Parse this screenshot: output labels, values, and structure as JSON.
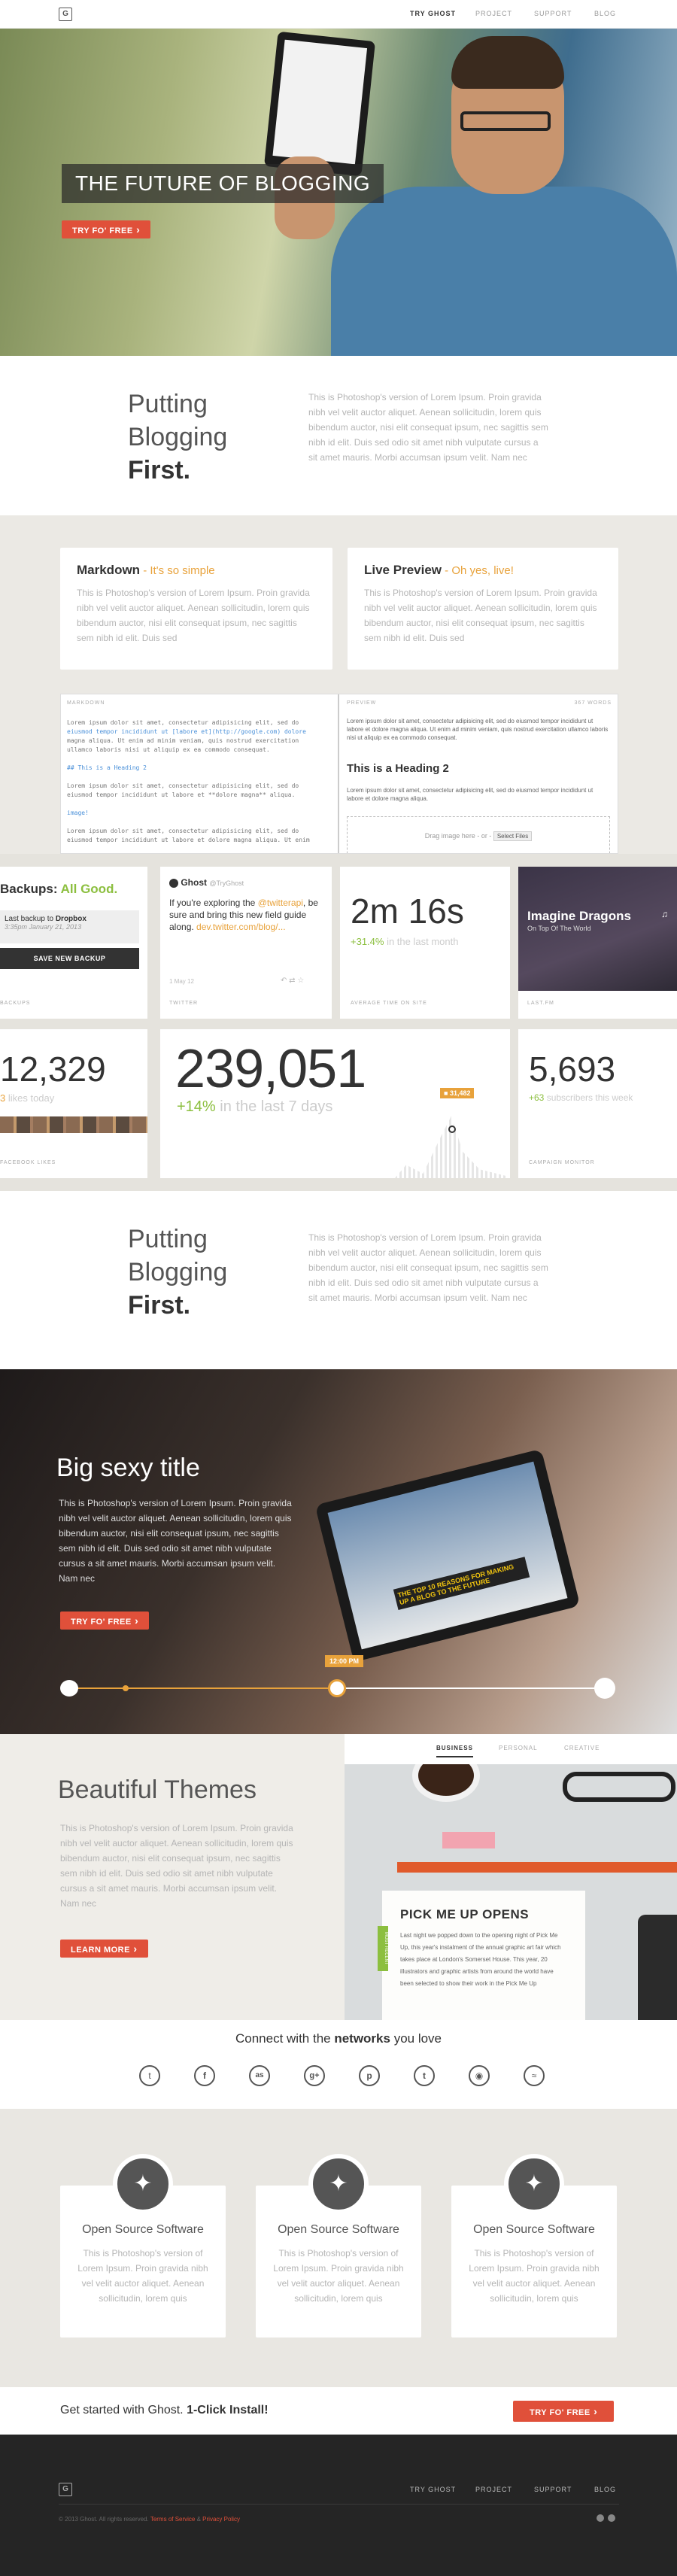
{
  "nav": {
    "logo": "G",
    "links": [
      "TRY GHOST",
      "PROJECT",
      "SUPPORT",
      "BLOG"
    ]
  },
  "hero": {
    "title": "THE FUTURE OF BLOGGING",
    "cta": "TRY FO' FREE"
  },
  "intro": {
    "line1": "Putting",
    "line2": "Blogging",
    "line3": "First.",
    "body": "This is Photoshop's version of Lorem Ipsum. Proin gravida nibh vel velit auctor aliquet. Aenean sollicitudin, lorem quis bibendum auctor, nisi elit consequat ipsum, nec sagittis sem nibh id elit. Duis sed odio sit amet nibh vulputate cursus a sit amet mauris. Morbi accumsan ipsum velit. Nam nec"
  },
  "editor": {
    "markdown_title": "Markdown",
    "markdown_sub": " - It's so simple",
    "markdown_body": "This is Photoshop's version of Lorem Ipsum. Proin gravida nibh vel velit auctor aliquet. Aenean sollicitudin, lorem quis bibendum auctor, nisi elit consequat ipsum, nec sagittis sem nibh id elit. Duis sed",
    "preview_title": "Live Preview",
    "preview_sub": " - Oh yes, live!",
    "preview_body": "This is Photoshop's version of Lorem Ipsum. Proin gravida nibh vel velit auctor aliquet. Aenean sollicitudin, lorem quis bibendum auctor, nisi elit consequat ipsum, nec sagittis sem nibh id elit. Duis sed",
    "md_label": "MARKDOWN",
    "pv_label": "PREVIEW",
    "word_count": "367 WORDS",
    "md_lines": [
      "Lorem ipsum dolor sit amet, consectetur adipisicing elit, sed do",
      "eiusmod tempor incididunt ut [labore et](http://google.com) dolore",
      "magna aliqua. Ut enim ad minim veniam, quis nostrud exercitation",
      "ullamco laboris nisi ut aliquip ex ea commodo consequat."
    ],
    "md_heading": "## This is a Heading 2",
    "md_lines2": [
      "Lorem ipsum dolor sit amet, consectetur adipisicing elit, sed do",
      "eiusmod tempor incididunt ut labore et **dolore magna** aliqua."
    ],
    "md_image": "image!",
    "md_lines3": [
      "Lorem ipsum dolor sit amet, consectetur adipisicing elit, sed do",
      "eiusmod tempor incididunt ut labore et dolore magna aliqua. Ut enim"
    ],
    "pv_text": "Lorem ipsum dolor sit amet, consectetur adipisicing elit, sed do eiusmod tempor incididunt ut labore et dolore magna aliqua. Ut enim ad minim veniam, quis nostrud exercitation ullamco laboris nisi ut aliquip ex ea commodo consequat.",
    "pv_heading": "This is a Heading 2",
    "pv_text2": "Lorem ipsum dolor sit amet, consectetur adipisicing elit, sed do eiusmod tempor incididunt ut labore et dolore magna aliqua.",
    "drop_text": "Drag image here - or -",
    "drop_btn": "Select Files"
  },
  "widgets": {
    "backups_title": "Backups:",
    "backups_good": "All Good.",
    "backup_last": "Last backup to",
    "backup_dest": "Dropbox",
    "backup_time": "3:35pm January 21, 2013",
    "backup_btn": "SAVE NEW BACKUP",
    "backup_label": "BACKUPS",
    "tw_name": "Ghost",
    "tw_handle": "@TryGhost",
    "tw_text1": "If you're exploring the",
    "tw_mention": "@twitterapi",
    "tw_text2": ", be sure and bring this new field guide along.",
    "tw_link": "dev.twitter.com/blog/...",
    "tw_date": "1 May 12",
    "tw_label": "TWITTER",
    "time_value": "2m 16s",
    "time_delta": "+31.4%",
    "time_sub": " in the last month",
    "time_label": "AVERAGE TIME ON SITE",
    "fm_artist": "Imagine Dragons",
    "fm_track": "On Top Of The World",
    "fm_label": "LAST.FM",
    "fb_value": "12,329",
    "fb_delta": "3",
    "fb_sub": " likes today",
    "fb_label": "FACEBOOK LIKES",
    "big_value": "239,051",
    "big_delta": "+14%",
    "big_sub": " in the last 7 days",
    "big_badge": "31,482",
    "cm_value": "5,693",
    "cm_delta": "+63",
    "cm_sub": " subscribers this week",
    "cm_label": "CAMPAIGN MONITOR"
  },
  "intro2": {
    "line1": "Putting",
    "line2": "Blogging",
    "line3": "First.",
    "body": "This is Photoshop's version of Lorem Ipsum. Proin gravida nibh vel velit auctor aliquet. Aenean sollicitudin, lorem quis bibendum auctor, nisi elit consequat ipsum, nec sagittis sem nibh id elit. Duis sed odio sit amet nibh vulputate cursus a sit amet mauris. Morbi accumsan ipsum velit. Nam nec"
  },
  "sexy": {
    "title": "Big sexy title",
    "body": "This is Photoshop's version of Lorem Ipsum. Proin gravida nibh vel velit auctor aliquet. Aenean sollicitudin, lorem quis bibendum auctor, nisi elit consequat ipsum, nec sagittis sem nibh id elit. Duis sed odio sit amet nibh vulputate cursus a sit amet mauris. Morbi accumsan ipsum velit. Nam nec",
    "cta": "TRY FO' FREE",
    "time": "12:00 PM",
    "tablet_headline": "THE TOP 10 REASONS FOR MAKING UP A BLOG TO THE FUTURE"
  },
  "themes": {
    "title": "Beautiful Themes",
    "body": "This is Photoshop's version of Lorem Ipsum. Proin gravida nibh vel velit auctor aliquet. Aenean sollicitudin, lorem quis bibendum auctor, nisi elit consequat ipsum, nec sagittis sem nibh id elit. Duis sed odio sit amet nibh vulputate cursus a sit amet mauris. Morbi accumsan ipsum velit. Nam nec",
    "cta": "LEARN MORE",
    "tabs": [
      "BUSINESS",
      "PERSONAL",
      "CREATIVE"
    ],
    "note_title": "PICK ME UP OPENS",
    "note_body": "Last night we popped down to the opening night of Pick Me Up, this year's instalment of the annual graphic art fair which takes place at London's Somerset House. This year, 20 illustrators and graphic artists from around the world have been selected to show their work in the Pick Me Up",
    "note_tag": "MOST RECENT"
  },
  "networks": {
    "text": "Connect with the ",
    "bold": "networks",
    "text2": " you love",
    "icons": [
      "twitter-icon",
      "facebook-icon",
      "lastfm-icon",
      "googleplus-icon",
      "pinterest-icon",
      "tumblr-icon",
      "dribbble-icon",
      "spotify-icon"
    ]
  },
  "features": [
    {
      "title": "Open Source Software",
      "body": "This is Photoshop's version of Lorem Ipsum. Proin gravida nibh vel velit auctor aliquet. Aenean sollicitudin, lorem quis"
    },
    {
      "title": "Open Source Software",
      "body": "This is Photoshop's version of Lorem Ipsum. Proin gravida nibh vel velit auctor aliquet. Aenean sollicitudin, lorem quis"
    },
    {
      "title": "Open Source Software",
      "body": "This is Photoshop's version of Lorem Ipsum. Proin gravida nibh vel velit auctor aliquet. Aenean sollicitudin, lorem quis"
    }
  ],
  "getstarted": {
    "text": "Get started with Ghost. ",
    "bold": "1-Click Install!",
    "cta": "TRY FO' FREE"
  },
  "footer": {
    "logo": "G",
    "links": [
      "TRY GHOST",
      "PROJECT",
      "SUPPORT",
      "BLOG"
    ],
    "copyright": "© 2013 Ghost. All rights reserved.",
    "terms": "Terms of Service",
    "amp": " & ",
    "privacy": "Privacy Policy"
  }
}
